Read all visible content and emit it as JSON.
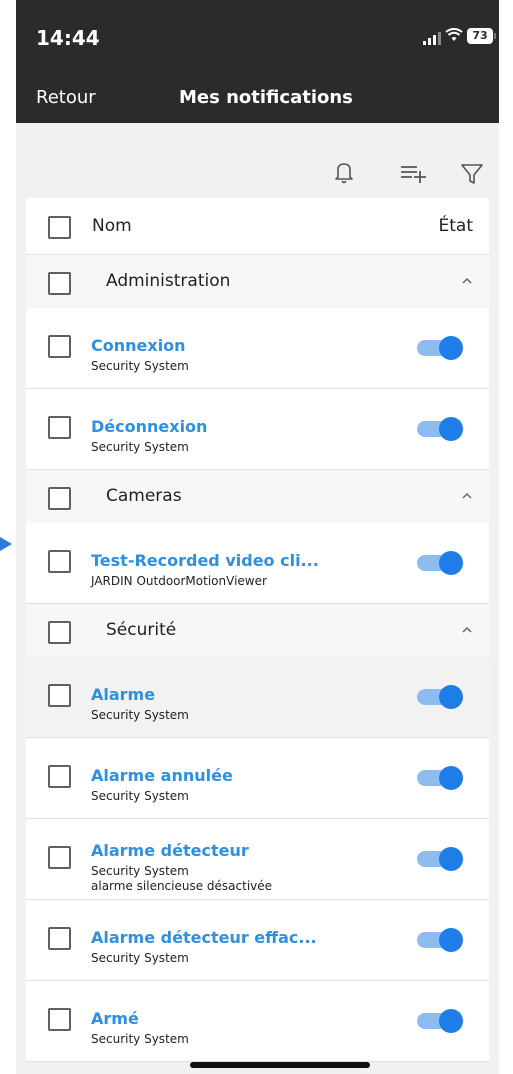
{
  "status": {
    "time": "14:44",
    "battery": "73"
  },
  "nav": {
    "back": "Retour",
    "title": "Mes notifications"
  },
  "toolbar": {
    "icons": [
      "bell-icon",
      "add-list-icon",
      "filter-icon"
    ]
  },
  "list_header": {
    "name_label": "Nom",
    "state_label": "État"
  },
  "groups": [
    {
      "name": "Administration",
      "items": [
        {
          "name": "Connexion",
          "subtitle": "Security System",
          "enabled": true
        },
        {
          "name": "Déconnexion",
          "subtitle": "Security System",
          "enabled": true
        }
      ]
    },
    {
      "name": "Cameras",
      "items": [
        {
          "name": "Test-Recorded video cli...",
          "subtitle": "JARDIN OutdoorMotionViewer",
          "enabled": true
        }
      ]
    },
    {
      "name": "Sécurité",
      "items": [
        {
          "name": "Alarme",
          "subtitle": "Security System",
          "enabled": true
        },
        {
          "name": "Alarme annulée",
          "subtitle": "Security System",
          "enabled": true
        },
        {
          "name": "Alarme détecteur",
          "subtitle": "Security System",
          "subtitle2": "alarme silencieuse désactivée",
          "enabled": true
        },
        {
          "name": "Alarme détecteur effac...",
          "subtitle": "Security System",
          "enabled": true
        },
        {
          "name": "Armé",
          "subtitle": "Security System",
          "enabled": true
        }
      ]
    }
  ],
  "colors": {
    "accent": "#2f8fe0",
    "toggle_on": "#1e7de6",
    "header_bg": "#2b2b2b"
  }
}
